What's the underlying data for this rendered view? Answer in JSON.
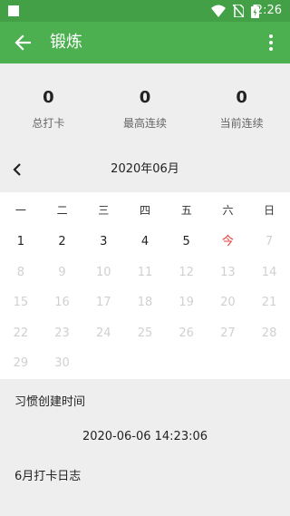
{
  "status_bar": {
    "time": "2:26"
  },
  "app_bar": {
    "title": "锻炼"
  },
  "stats": [
    {
      "value": "0",
      "label": "总打卡"
    },
    {
      "value": "0",
      "label": "最高连续"
    },
    {
      "value": "0",
      "label": "当前连续"
    }
  ],
  "calendar": {
    "month_title": "2020年06月",
    "weekdays": [
      "一",
      "二",
      "三",
      "四",
      "五",
      "六",
      "日"
    ],
    "days": [
      "1",
      "2",
      "3",
      "4",
      "5",
      "今",
      "7",
      "8",
      "9",
      "10",
      "11",
      "12",
      "13",
      "14",
      "15",
      "16",
      "17",
      "18",
      "19",
      "20",
      "21",
      "22",
      "23",
      "24",
      "25",
      "26",
      "27",
      "28",
      "29",
      "30"
    ],
    "active_days": 5,
    "today_label": "今"
  },
  "habit_created": {
    "label": "习惯创建时间",
    "time": "2020-06-06 14:23:06"
  },
  "log": {
    "label": "6月打卡日志"
  },
  "colors": {
    "appbar": "#4caf50",
    "statusbar": "#43a047",
    "today": "#e53935",
    "inactive": "#d0d0d0"
  }
}
